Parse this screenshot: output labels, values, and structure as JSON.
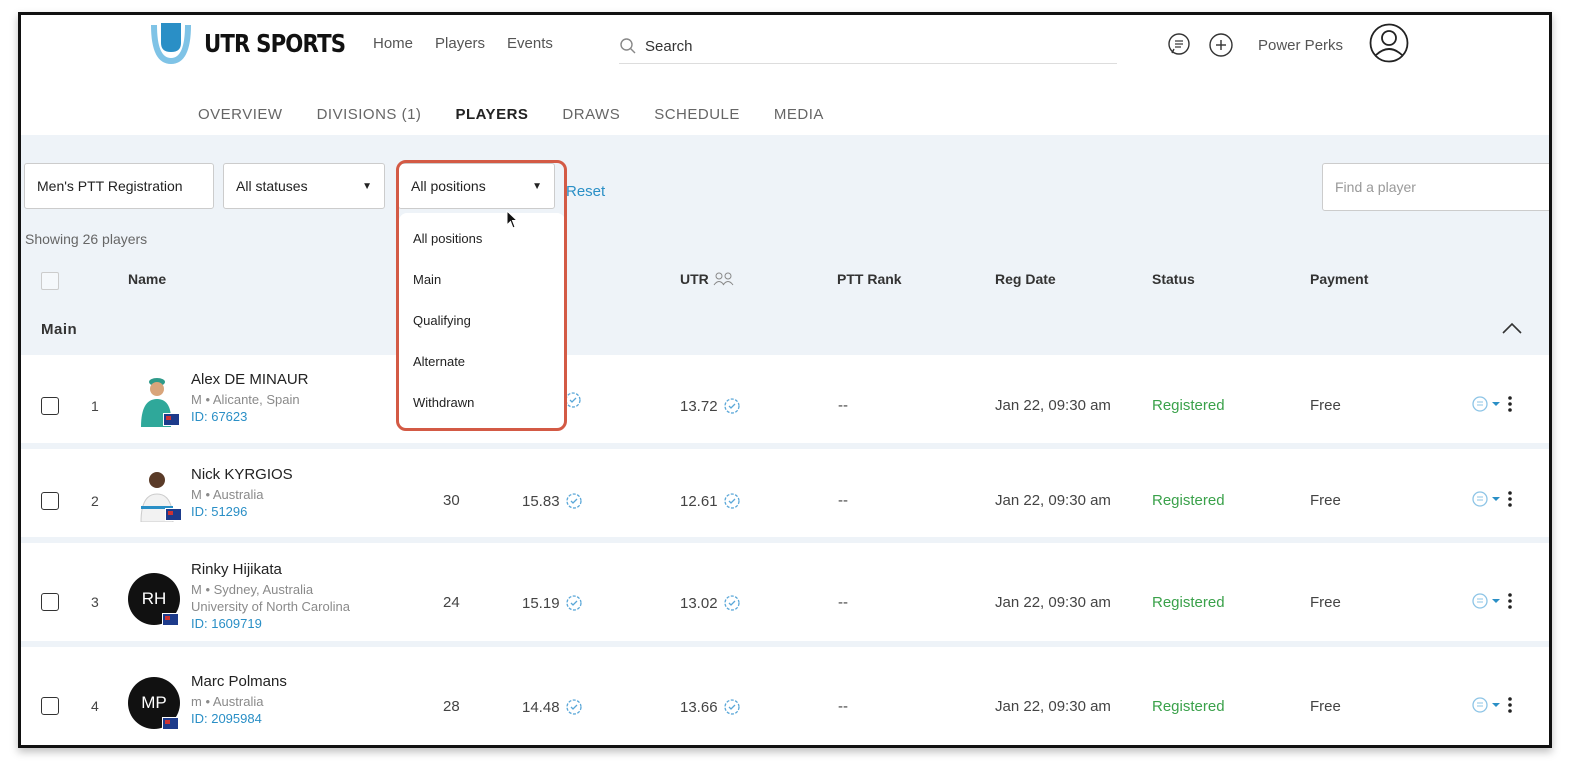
{
  "header": {
    "brand": "UTR SPORTS",
    "nav": [
      "Home",
      "Players",
      "Events"
    ],
    "search_placeholder": "Search",
    "power_perks": "Power Perks"
  },
  "tabs": [
    "OVERVIEW",
    "DIVISIONS (1)",
    "PLAYERS",
    "DRAWS",
    "SCHEDULE",
    "MEDIA"
  ],
  "active_tab": "PLAYERS",
  "filters": {
    "registration": "Men's PTT Registration",
    "status": "All statuses",
    "position": "All positions",
    "reset": "Reset",
    "find_placeholder": "Find a player"
  },
  "dropdown_options": [
    "All positions",
    "Main",
    "Qualifying",
    "Alternate",
    "Withdrawn"
  ],
  "showing": "Showing 26 players",
  "columns": {
    "name": "Name",
    "utr": "UTR",
    "ptt_rank": "PTT Rank",
    "reg_date": "Reg Date",
    "status": "Status",
    "payment": "Payment"
  },
  "section": "Main",
  "players": [
    {
      "num": "1",
      "name": "Alex DE MINAUR",
      "sub": "M • Alicante, Spain",
      "school": "",
      "id": "ID: 67623",
      "initials": "",
      "age": "",
      "utr1": "",
      "utr2": "13.72",
      "rank": "--",
      "date": "Jan 22, 09:30 am",
      "status": "Registered",
      "payment": "Free"
    },
    {
      "num": "2",
      "name": "Nick KYRGIOS",
      "sub": "M • Australia",
      "school": "",
      "id": "ID: 51296",
      "initials": "",
      "age": "30",
      "utr1": "15.83",
      "utr2": "12.61",
      "rank": "--",
      "date": "Jan 22, 09:30 am",
      "status": "Registered",
      "payment": "Free"
    },
    {
      "num": "3",
      "name": "Rinky Hijikata",
      "sub": "M • Sydney, Australia",
      "school": "University of North Carolina",
      "id": "ID: 1609719",
      "initials": "RH",
      "age": "24",
      "utr1": "15.19",
      "utr2": "13.02",
      "rank": "--",
      "date": "Jan 22, 09:30 am",
      "status": "Registered",
      "payment": "Free"
    },
    {
      "num": "4",
      "name": "Marc Polmans",
      "sub": "m • Australia",
      "school": "",
      "id": "ID: 2095984",
      "initials": "MP",
      "age": "28",
      "utr1": "14.48",
      "utr2": "13.66",
      "rank": "--",
      "date": "Jan 22, 09:30 am",
      "status": "Registered",
      "payment": "Free"
    }
  ],
  "colors": {
    "accent": "#2a8fc6",
    "registered": "#3aa14a",
    "highlight": "#d35a45",
    "band": "#eef3f8"
  }
}
